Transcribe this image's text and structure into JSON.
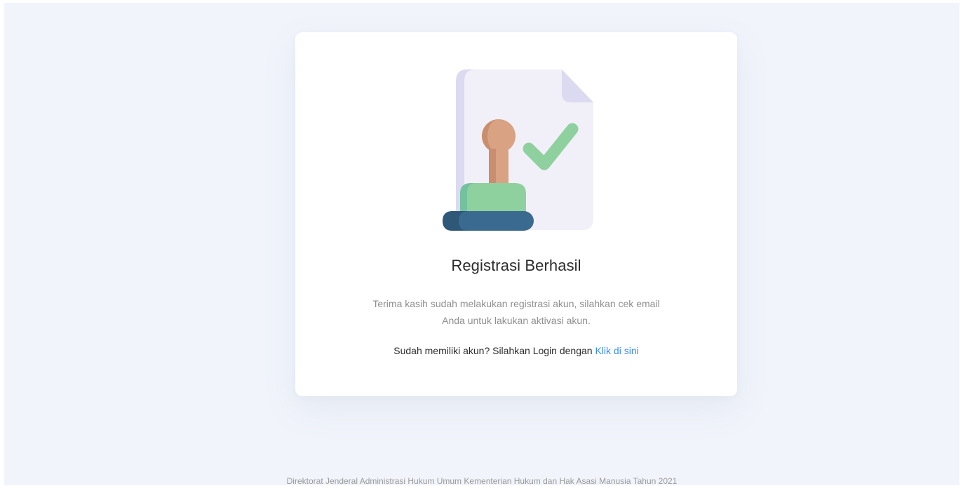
{
  "card": {
    "title": "Registrasi Berhasil",
    "description_line1": "Terima kasih sudah melakukan registrasi akun, silahkan cek email",
    "description_line2": "Anda untuk lakukan aktivasi akun.",
    "login_prompt": "Sudah memiliki akun? Silahkan Login dengan ",
    "login_link": "Klik di sini",
    "illustration_icon": "stamp-approved-document-icon"
  },
  "footer": {
    "text": "Direktorat Jenderal Administrasi Hukum Umum Kementerian Hukum dan Hak Asasi Manusia Tahun 2021"
  },
  "colors": {
    "page_background": "#f1f4fb",
    "card_background": "#ffffff",
    "link": "#3d8cf0",
    "check_green": "#8fd19e",
    "stamp_handle": "#d9a283",
    "stamp_base": "#3b6a91"
  }
}
